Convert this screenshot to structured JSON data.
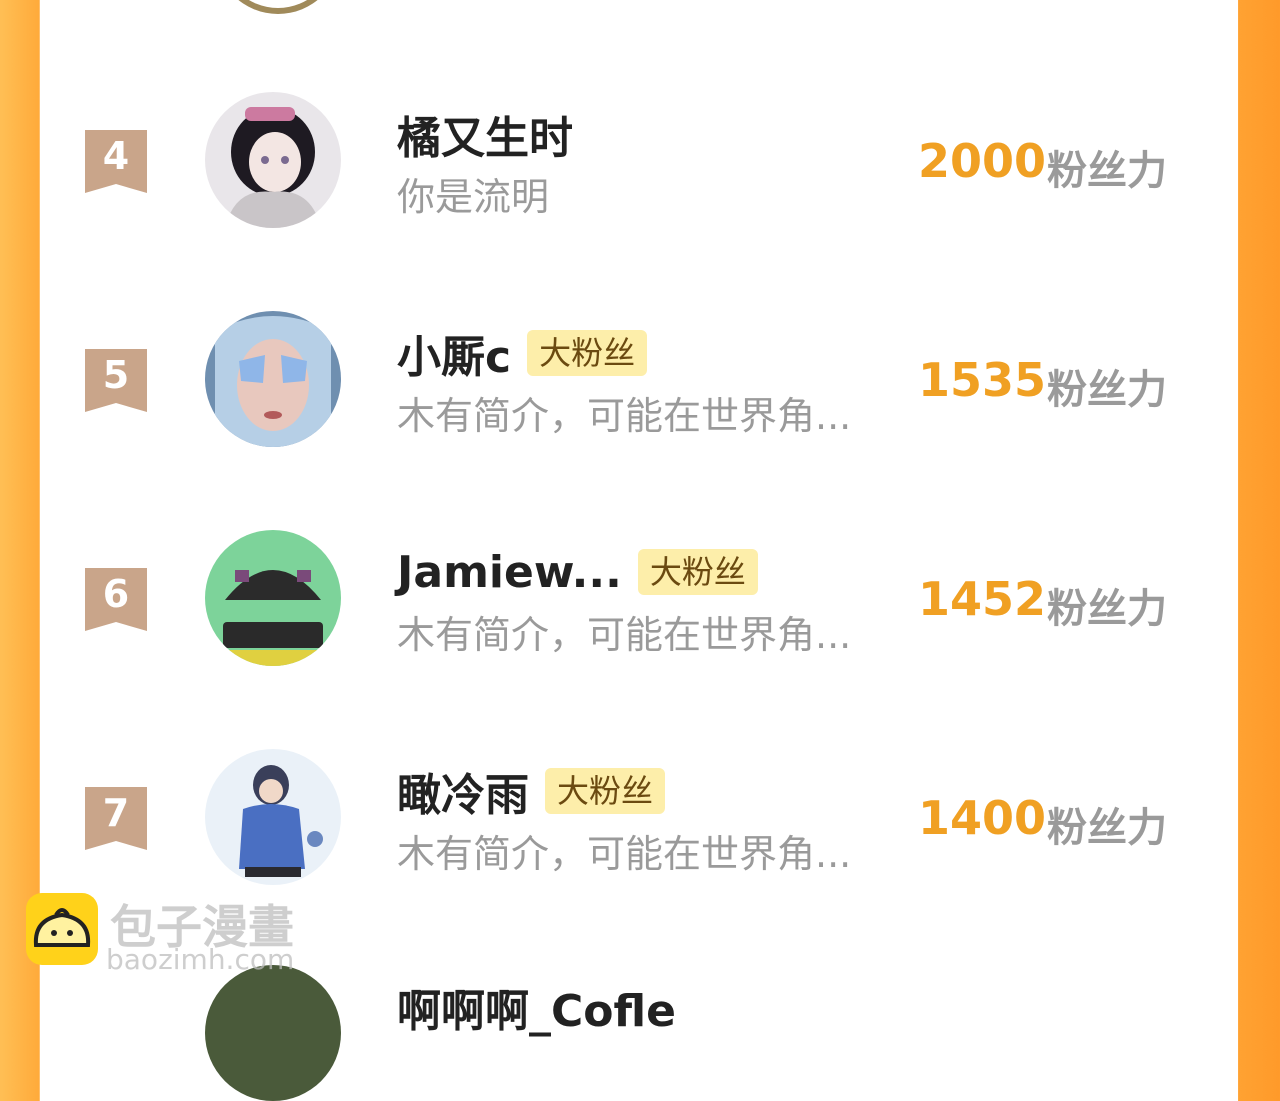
{
  "colors": {
    "score": "#f0a023",
    "tag_bg": "#fdeeaa",
    "tag_text": "#6b4a10",
    "rank_badge": "#c9a58a",
    "side_orange": "#ffa232"
  },
  "ranking": {
    "rows": [
      {
        "rank": "4",
        "name": "橘又生时",
        "tag": "",
        "bio": "你是流明",
        "score": "2000",
        "unit": "粉丝力",
        "avatar_icon": "anime-girl-avatar"
      },
      {
        "rank": "5",
        "name": "小厮c",
        "tag": "大粉丝",
        "bio": "木有简介，可能在世界角...",
        "score": "1535",
        "unit": "粉丝力",
        "avatar_icon": "blue-makeup-face-avatar"
      },
      {
        "rank": "6",
        "name": "Jamiew...",
        "tag": "大粉丝",
        "bio": "木有简介，可能在世界角...",
        "score": "1452",
        "unit": "粉丝力",
        "avatar_icon": "adidas-logo-avatar"
      },
      {
        "rank": "7",
        "name": "瞰冷雨",
        "tag": "大粉丝",
        "bio": "木有简介，可能在世界角...",
        "score": "1400",
        "unit": "粉丝力",
        "avatar_icon": "child-figure-avatar"
      }
    ],
    "partial_next_name": "啊啊啊_Cofle"
  },
  "watermark": {
    "title": "包子漫畫",
    "url": "baozimh.com",
    "logo_icon": "bun-mascot-icon"
  }
}
